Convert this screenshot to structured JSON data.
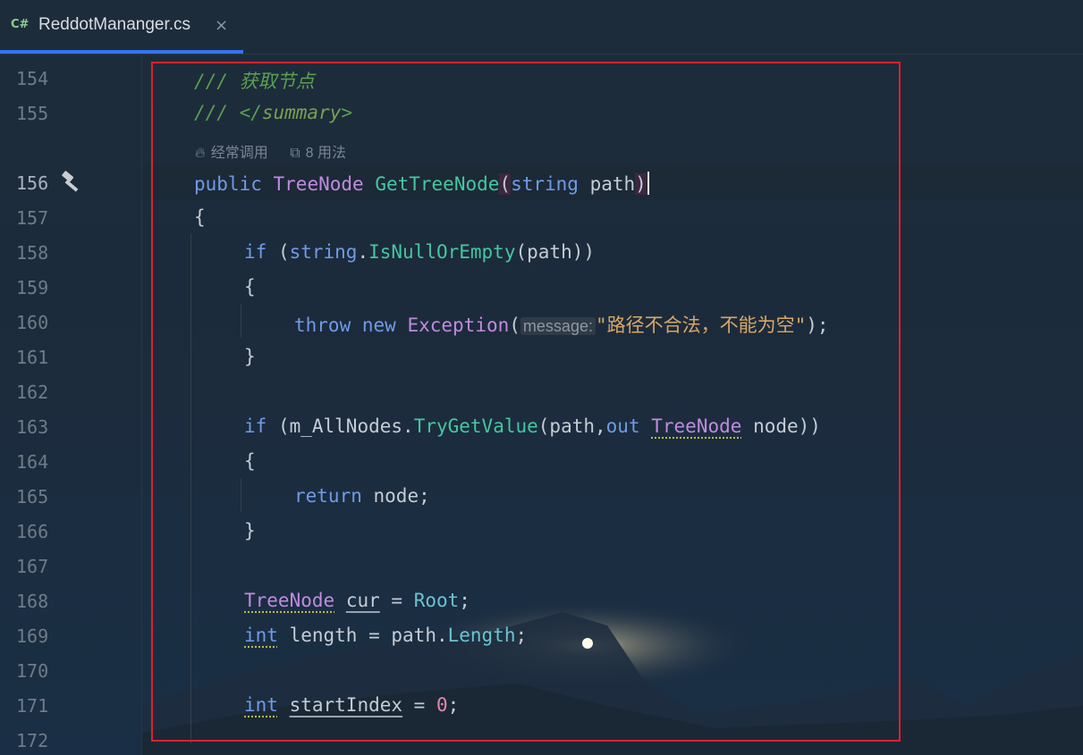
{
  "tab": {
    "lang": "C#",
    "filename": "ReddotMananger.cs",
    "close_glyph": "×"
  },
  "gutter": {
    "line_numbers": [
      "154",
      "155",
      "156",
      "157",
      "158",
      "159",
      "160",
      "161",
      "162",
      "163",
      "164",
      "165",
      "166",
      "167",
      "168",
      "169",
      "170",
      "171",
      "172"
    ],
    "hammer_icon": "hammer-icon"
  },
  "code_vision": {
    "hot_label": "经常调用",
    "usages_label": "8 用法"
  },
  "code": {
    "l154_comment": "/// 获取节点",
    "l155_comment_prefix": "/// </",
    "l155_tag": "summary",
    "l155_close": ">",
    "kw_public": "public",
    "type_treenode": "TreeNode",
    "fn_gettreenode": "GetTreeNode",
    "kw_string": "string",
    "id_path": "path",
    "brace_open": "{",
    "brace_close": "}",
    "kw_if": "if",
    "fn_isnullorempty": "IsNullOrEmpty",
    "kw_throw": "throw",
    "kw_new": "new",
    "ty_exception": "Exception",
    "hint_message": "message:",
    "str_error": "\"路径不合法，不能为空\"",
    "id_m_allnodes": "m_AllNodes",
    "fn_trygetvalue": "TryGetValue",
    "kw_out": "out",
    "id_node": "node",
    "kw_return": "return",
    "id_cur": "cur",
    "prop_root": "Root",
    "kw_int": "int",
    "id_length": "length",
    "prop_length": "Length",
    "id_startindex": "startIndex",
    "num_zero": "0"
  }
}
